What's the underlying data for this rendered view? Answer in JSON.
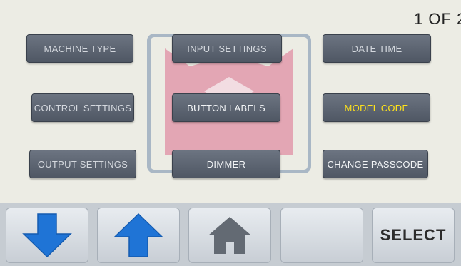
{
  "page_indicator": "1 OF 2",
  "menu": {
    "machine_type": "MACHINE TYPE",
    "input_settings": "INPUT SETTINGS",
    "date_time": "DATE TIME",
    "control_settings": "CONTROL SETTINGS",
    "button_labels": "BUTTON LABELS",
    "model_code": "MODEL CODE",
    "output_settings": "OUTPUT SETTINGS",
    "dimmer": "DIMMER",
    "change_passcode": "CHANGE PASSCODE"
  },
  "nav": {
    "down_icon": "arrow-down-icon",
    "up_icon": "arrow-up-icon",
    "home_icon": "home-icon",
    "select_label": "SELECT"
  },
  "colors": {
    "button_bg": "#5f6773",
    "highlight_text": "#ffe21a",
    "arrow_blue": "#1f74d6",
    "logo_pink": "#e3a6b4"
  }
}
